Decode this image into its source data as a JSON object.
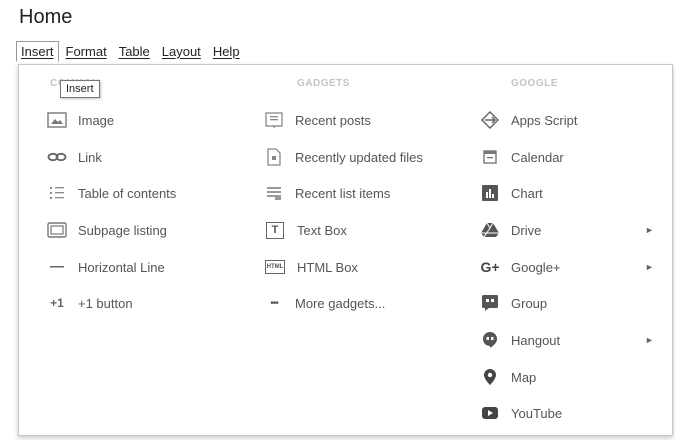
{
  "page_title": "Home",
  "menu": {
    "insert": "Insert",
    "format": "Format",
    "table": "Table",
    "layout": "Layout",
    "help": "Help"
  },
  "tooltip": "Insert",
  "columns": {
    "common": {
      "heading": "COMMON",
      "items": [
        {
          "label": "Image",
          "icon": "image-icon"
        },
        {
          "label": "Link",
          "icon": "link-icon"
        },
        {
          "label": "Table of contents",
          "icon": "table-of-contents-icon"
        },
        {
          "label": "Subpage listing",
          "icon": "subpage-listing-icon"
        },
        {
          "label": "Horizontal Line",
          "icon": "horizontal-line-icon"
        },
        {
          "label": "+1 button",
          "icon": "plus-one-icon",
          "icon_text": "+1"
        }
      ]
    },
    "gadgets": {
      "heading": "GADGETS",
      "items": [
        {
          "label": "Recent posts",
          "icon": "recent-posts-icon"
        },
        {
          "label": "Recently updated files",
          "icon": "recently-updated-files-icon"
        },
        {
          "label": "Recent list items",
          "icon": "recent-list-items-icon"
        },
        {
          "label": "Text Box",
          "icon": "text-box-icon",
          "icon_text": "T"
        },
        {
          "label": "HTML Box",
          "icon": "html-box-icon",
          "icon_text": "HTML"
        },
        {
          "label": "More gadgets...",
          "icon": "more-gadgets-icon",
          "icon_text": "•••"
        }
      ]
    },
    "google": {
      "heading": "GOOGLE",
      "items": [
        {
          "label": "Apps Script",
          "icon": "apps-script-icon"
        },
        {
          "label": "Calendar",
          "icon": "calendar-icon"
        },
        {
          "label": "Chart",
          "icon": "chart-icon"
        },
        {
          "label": "Drive",
          "icon": "drive-icon",
          "submenu": true
        },
        {
          "label": "Google+",
          "icon": "google-plus-icon",
          "icon_text": "G+",
          "submenu": true
        },
        {
          "label": "Group",
          "icon": "group-icon"
        },
        {
          "label": "Hangout",
          "icon": "hangout-icon",
          "submenu": true
        },
        {
          "label": "Map",
          "icon": "map-pin-icon"
        },
        {
          "label": "YouTube",
          "icon": "youtube-icon"
        }
      ]
    }
  },
  "submenu_arrow": "►"
}
